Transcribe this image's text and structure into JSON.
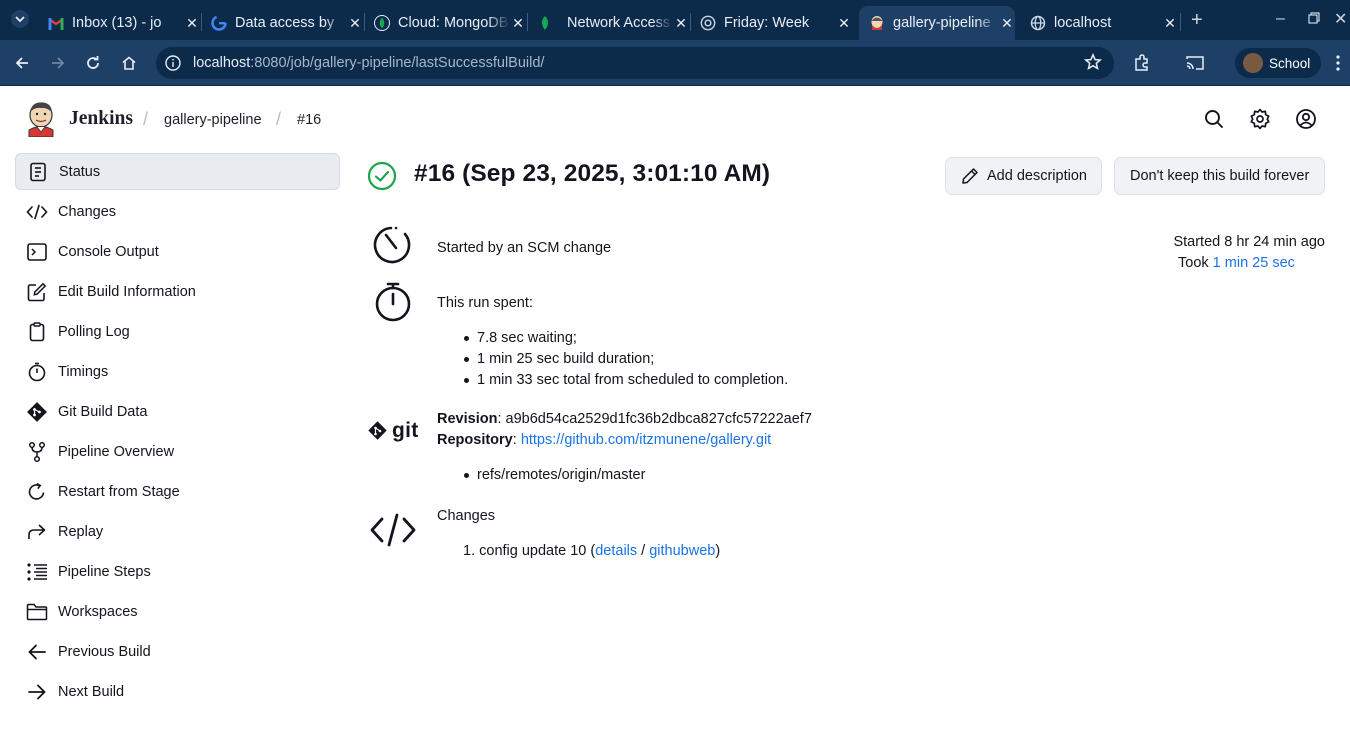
{
  "browser": {
    "tabs": [
      {
        "title": "Inbox (13) - jo",
        "favicon": "gmail-icon"
      },
      {
        "title": "Data access by",
        "favicon": "google-icon"
      },
      {
        "title": "Cloud: MongoDB",
        "favicon": "mongodb-leaf-icon"
      },
      {
        "title": "Network Access",
        "favicon": "mongodb-leaf-icon"
      },
      {
        "title": "Friday: Week",
        "favicon": "globe-icon"
      },
      {
        "title": "gallery-pipeline",
        "favicon": "jenkins-icon"
      },
      {
        "title": "localhost",
        "favicon": "globe-icon"
      }
    ],
    "active_tab_index": 5,
    "url_host": "localhost",
    "url_rest": ":8080/job/gallery-pipeline/lastSuccessfulBuild/",
    "profile_name": "School"
  },
  "header": {
    "app_name": "Jenkins",
    "breadcrumbs": [
      "gallery-pipeline",
      "#16"
    ]
  },
  "sidebar": {
    "items": [
      {
        "label": "Status",
        "icon": "document-icon"
      },
      {
        "label": "Changes",
        "icon": "code-icon"
      },
      {
        "label": "Console Output",
        "icon": "terminal-icon"
      },
      {
        "label": "Edit Build Information",
        "icon": "edit-icon"
      },
      {
        "label": "Polling Log",
        "icon": "clipboard-icon"
      },
      {
        "label": "Timings",
        "icon": "stopwatch-icon"
      },
      {
        "label": "Git Build Data",
        "icon": "git-icon"
      },
      {
        "label": "Pipeline Overview",
        "icon": "git-branch-icon"
      },
      {
        "label": "Restart from Stage",
        "icon": "restart-icon"
      },
      {
        "label": "Replay",
        "icon": "replay-icon"
      },
      {
        "label": "Pipeline Steps",
        "icon": "list-icon"
      },
      {
        "label": "Workspaces",
        "icon": "folder-icon"
      },
      {
        "label": "Previous Build",
        "icon": "arrow-left-icon"
      },
      {
        "label": "Next Build",
        "icon": "arrow-right-icon"
      }
    ]
  },
  "build": {
    "title": "#16 (Sep 23, 2025, 3:01:10 AM)",
    "status_color": "#1ea64b",
    "add_description_label": "Add description",
    "keep_forever_label": "Don't keep this build forever",
    "cause": "Started by an SCM change",
    "started": "Started 8 hr 24 min ago",
    "took_prefix": "Took",
    "took_value": "1 min 25 sec",
    "spent_heading": "This run spent:",
    "spent_items": [
      "7.8 sec waiting;",
      "1 min 25 sec build duration;",
      "1 min 33 sec total from scheduled to completion."
    ],
    "git_logo_text": "git",
    "revision_label": "Revision",
    "revision_value": "a9b6d54ca2529d1fc36b2dbca827cfc57222aef7",
    "repository_label": "Repository",
    "repository_url": "https://github.com/itzmunene/gallery.git",
    "refs": [
      "refs/remotes/origin/master"
    ],
    "changes_heading": "Changes",
    "change_number": "1.",
    "change_text": "config update 10",
    "change_details_link": "details",
    "change_separator": "/",
    "change_githubweb_link": "githubweb"
  }
}
